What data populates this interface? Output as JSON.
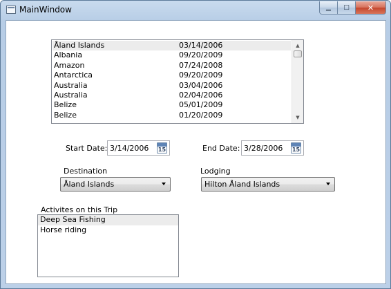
{
  "window": {
    "title": "MainWindow",
    "buttons": {
      "minimize": "▁",
      "maximize": "□",
      "close": "✕"
    }
  },
  "countries": [
    {
      "name": "Åland Islands",
      "date": "03/14/2006",
      "selected": true
    },
    {
      "name": "Albania",
      "date": "09/20/2009"
    },
    {
      "name": "Amazon",
      "date": "07/24/2008"
    },
    {
      "name": "Antarctica",
      "date": "09/20/2009"
    },
    {
      "name": "Australia",
      "date": "03/04/2006"
    },
    {
      "name": "Australia",
      "date": "02/04/2006"
    },
    {
      "name": "Belize",
      "date": "05/01/2009"
    },
    {
      "name": "Belize",
      "date": "01/20/2009"
    }
  ],
  "dates": {
    "start_label": "Start Date:",
    "start_value": "3/14/2006",
    "end_label": "End Date:",
    "end_value": "3/28/2006",
    "calendar_day": "15"
  },
  "destination": {
    "label": "Destination",
    "value": "Åland Islands"
  },
  "lodging": {
    "label": "Lodging",
    "value": "Hilton Åland Islands"
  },
  "activities": {
    "label": "Activites on this Trip",
    "items": [
      {
        "name": "Deep Sea Fishing",
        "selected": true
      },
      {
        "name": "Horse riding"
      }
    ]
  },
  "colors": {
    "selection": "#ececec",
    "title_bar": "#c9dbee",
    "close_button": "#c4462d"
  }
}
